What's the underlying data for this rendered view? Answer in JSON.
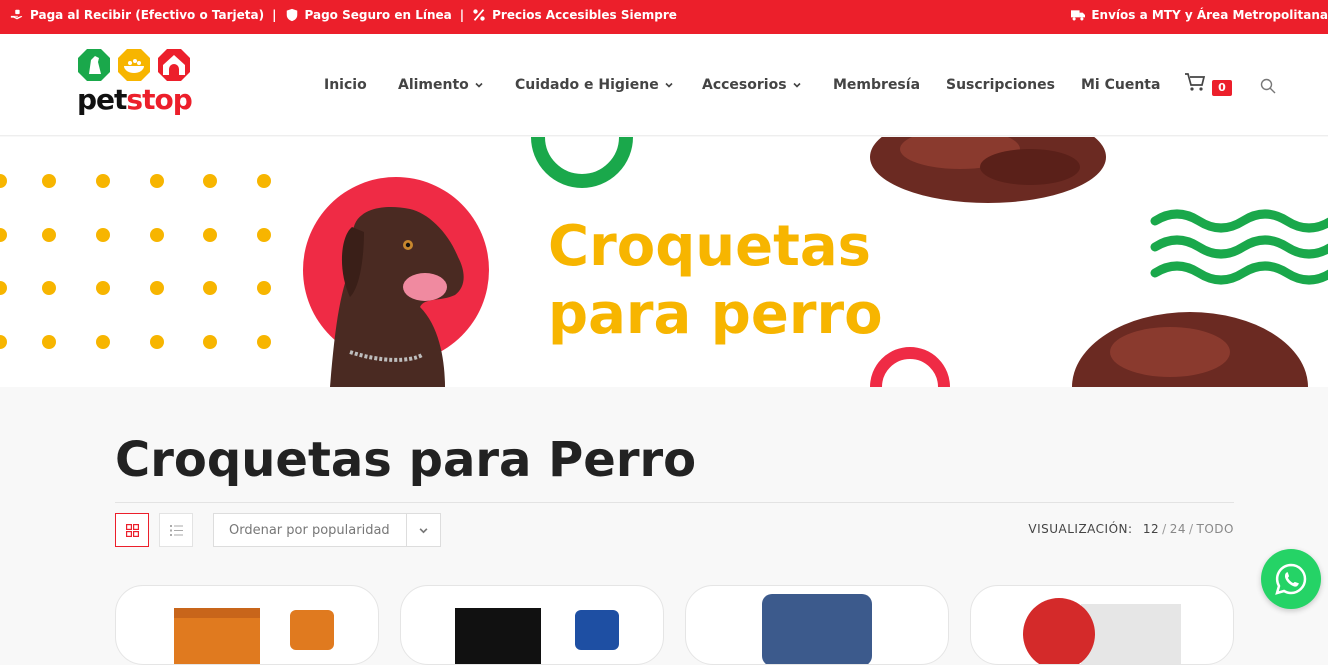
{
  "topbar": {
    "items": [
      {
        "icon": "hand-cash-icon",
        "label": "Paga al Recibir (Efectivo o Tarjeta)"
      },
      {
        "icon": "shield-icon",
        "label": "Pago Seguro en Línea"
      },
      {
        "icon": "percent-icon",
        "label": "Precios Accesibles Siempre"
      }
    ],
    "separator": "|",
    "shipping": {
      "icon": "truck-icon",
      "label": "Envíos a MTY y Área Metropolitana"
    }
  },
  "brand": {
    "pet": "pet",
    "stop": "stop"
  },
  "nav": {
    "items": [
      {
        "label": "Inicio",
        "dropdown": false
      },
      {
        "label": "Alimento",
        "dropdown": true
      },
      {
        "label": "Cuidado e Higiene",
        "dropdown": true
      },
      {
        "label": "Accesorios",
        "dropdown": true
      },
      {
        "label": "Membresía",
        "dropdown": false
      },
      {
        "label": "Suscripciones",
        "dropdown": false
      },
      {
        "label": "Mi Cuenta",
        "dropdown": false
      }
    ],
    "cart_count": "0"
  },
  "hero": {
    "line1": "Croquetas",
    "line2": "para perro"
  },
  "page": {
    "title": "Croquetas para Perro"
  },
  "toolbar": {
    "sort_label": "Ordenar por popularidad",
    "viewing_label": "VISUALIZACIÓN:",
    "options": [
      "12",
      "24",
      "TODO"
    ]
  },
  "colors": {
    "brand_red": "#ec1f2b",
    "brand_yellow": "#f7b500",
    "brand_green": "#1aa84b",
    "whatsapp": "#25d366"
  }
}
